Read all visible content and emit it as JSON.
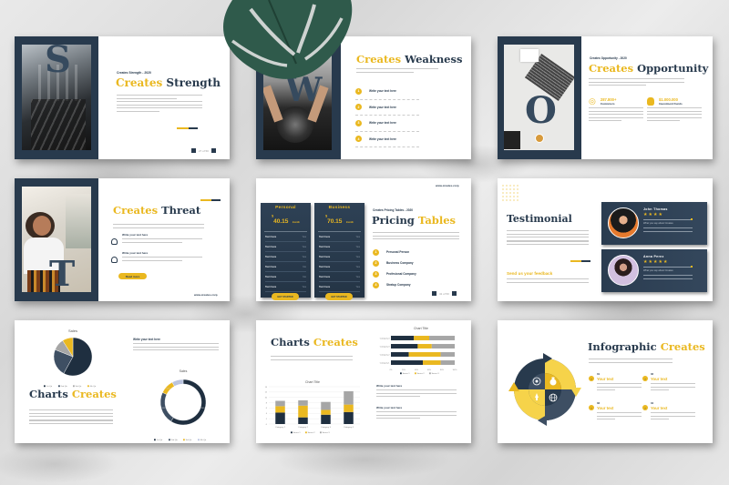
{
  "colors": {
    "navy": "#283a4d",
    "yellow": "#eab820",
    "gray": "#a6a6a6",
    "slate": "#3e4f63"
  },
  "slides": {
    "strength": {
      "letter": "S",
      "kicker": "Creates Strength - 2020",
      "title_yellow": "Creates",
      "title_dark": "Strength",
      "pager": "27 of 50"
    },
    "weakness": {
      "letter": "W",
      "title_yellow": "Creates",
      "title_dark": "Weakness",
      "items": [
        {
          "num": "1",
          "label": "Write your text here"
        },
        {
          "num": "2",
          "label": "Write your text here"
        },
        {
          "num": "3",
          "label": "Write your text here"
        },
        {
          "num": "4",
          "label": "Write your text here"
        }
      ]
    },
    "opportunity": {
      "letter": "O",
      "kicker": "Creates Opportunity - 2020",
      "title_yellow": "Creates",
      "title_dark": "Opportunity",
      "stats": [
        {
          "icon": "target-icon",
          "value": "287.800+",
          "label": "Customers"
        },
        {
          "icon": "money-bag-icon",
          "value": "$1.000.000",
          "label": "Investment Funds"
        }
      ]
    },
    "threat": {
      "letter": "T",
      "title_yellow": "Creates",
      "title_dark": "Threat",
      "items": [
        {
          "label": "Write your text here"
        },
        {
          "label": "Write your text here"
        }
      ],
      "button": "Read more",
      "url": "www.creates.corp"
    },
    "pricing": {
      "url": "www.creates.corp",
      "kicker": "Creates Pricing Tables - 2020",
      "title_dark": "Pricing",
      "title_yellow": "Tables",
      "plans": [
        {
          "name": "Personal",
          "price": "40.15",
          "currency": "$",
          "period": "/month",
          "rows": [
            [
              "Text here",
              "Yes"
            ],
            [
              "Text here",
              "Yes"
            ],
            [
              "Text here",
              "Yes"
            ],
            [
              "Text here",
              "No"
            ],
            [
              "Text here",
              "No"
            ],
            [
              "Text here",
              "Yes"
            ]
          ],
          "button": "GET STARTED"
        },
        {
          "name": "Business",
          "price": "70.15",
          "currency": "$",
          "period": "/month",
          "rows": [
            [
              "Text here",
              "Yes"
            ],
            [
              "Text here",
              "Yes"
            ],
            [
              "Text here",
              "Yes"
            ],
            [
              "Text here",
              "Yes"
            ],
            [
              "Text here",
              "Yes"
            ],
            [
              "Text here",
              "Yes"
            ]
          ],
          "button": "GET STARTED"
        }
      ],
      "features": [
        {
          "num": "1",
          "label": "Personal Person"
        },
        {
          "num": "2",
          "label": "Business Company"
        },
        {
          "num": "3",
          "label": "Profesional Company"
        },
        {
          "num": "4",
          "label": "Stratup Company"
        }
      ],
      "pager": "41 of 50"
    },
    "testimonial": {
      "title": "Testimonial",
      "feedback_title": "Send us your feedback",
      "cards": [
        {
          "name": "John Thomas",
          "stars": 4,
          "subtitle": "What you say about Creates"
        },
        {
          "name": "Anna Perez",
          "stars": 5,
          "subtitle": "What you say about Creates"
        }
      ]
    },
    "charts1": {
      "title_dark": "Charts",
      "title_yellow": "Creates",
      "side_heading": "Write your text here"
    },
    "charts2": {
      "title_dark": "Charts",
      "title_yellow": "Creates",
      "notes": [
        {
          "heading": "Write your text here"
        },
        {
          "heading": "Write your text here"
        }
      ]
    },
    "infographic": {
      "title_dark": "Infographic",
      "title_yellow": "Creates",
      "items": [
        {
          "num": "01",
          "title": "Your text"
        },
        {
          "num": "02",
          "title": "Your text"
        },
        {
          "num": "03",
          "title": "Your text"
        },
        {
          "num": "04",
          "title": "Your text"
        }
      ],
      "icons": [
        "target-icon",
        "money-bag-icon",
        "rocket-icon",
        "globe-icon"
      ]
    }
  },
  "chart_data": [
    {
      "type": "pie",
      "title": "Sales",
      "categories": [
        "1st Qtr",
        "2nd Qtr",
        "3rd Qtr",
        "4th Qtr"
      ],
      "values": [
        58,
        23,
        10,
        9
      ],
      "colors": [
        "#1f2f40",
        "#3e4f63",
        "#a6a6a6",
        "#eab820"
      ],
      "legend": "bottom"
    },
    {
      "type": "pie",
      "subtype": "doughnut",
      "title": "Sales",
      "categories": [
        "1st Qtr",
        "2nd Qtr",
        "3rd Qtr",
        "4th Qtr"
      ],
      "values": [
        59,
        23,
        10,
        8
      ],
      "data_labels": [
        "59%",
        "23%",
        "10%",
        "8%"
      ],
      "colors": [
        "#1f2f40",
        "#3e4f63",
        "#eab820",
        "#b9c3df"
      ],
      "legend": "bottom"
    },
    {
      "type": "bar",
      "subtype": "stacked",
      "title": "Chart Title",
      "categories": [
        "Category 1",
        "Category 2",
        "Category 3",
        "Category 4"
      ],
      "series": [
        {
          "name": "Series 1",
          "values": [
            4.3,
            2.5,
            3.5,
            4.5
          ],
          "color": "#1f2f40"
        },
        {
          "name": "Series 2",
          "values": [
            2.4,
            4.4,
            1.8,
            2.8
          ],
          "color": "#eab820"
        },
        {
          "name": "Series 3",
          "values": [
            2.0,
            2.0,
            3.0,
            5.0
          ],
          "color": "#a6a6a6"
        }
      ],
      "ylim": [
        0,
        14
      ],
      "yticks": [
        0,
        2,
        4,
        6,
        8,
        10,
        12,
        14
      ],
      "grid": true,
      "legend": "bottom"
    },
    {
      "type": "bar",
      "subtype": "horizontal-stacked-100",
      "title": "Chart Title",
      "categories": [
        "Category 1",
        "Category 2",
        "Category 3",
        "Category 4"
      ],
      "series": [
        {
          "name": "Series 1",
          "values": [
            50,
            28,
            42,
            36
          ],
          "color": "#1f2f40"
        },
        {
          "name": "Series 2",
          "values": [
            28,
            50,
            22,
            24
          ],
          "color": "#eab820"
        },
        {
          "name": "Series 3",
          "values": [
            22,
            22,
            36,
            40
          ],
          "color": "#a6a6a6"
        }
      ],
      "xlim": [
        0,
        100
      ],
      "xticks": [
        "0%",
        "20%",
        "40%",
        "60%",
        "80%",
        "100%"
      ],
      "legend": "bottom"
    }
  ]
}
